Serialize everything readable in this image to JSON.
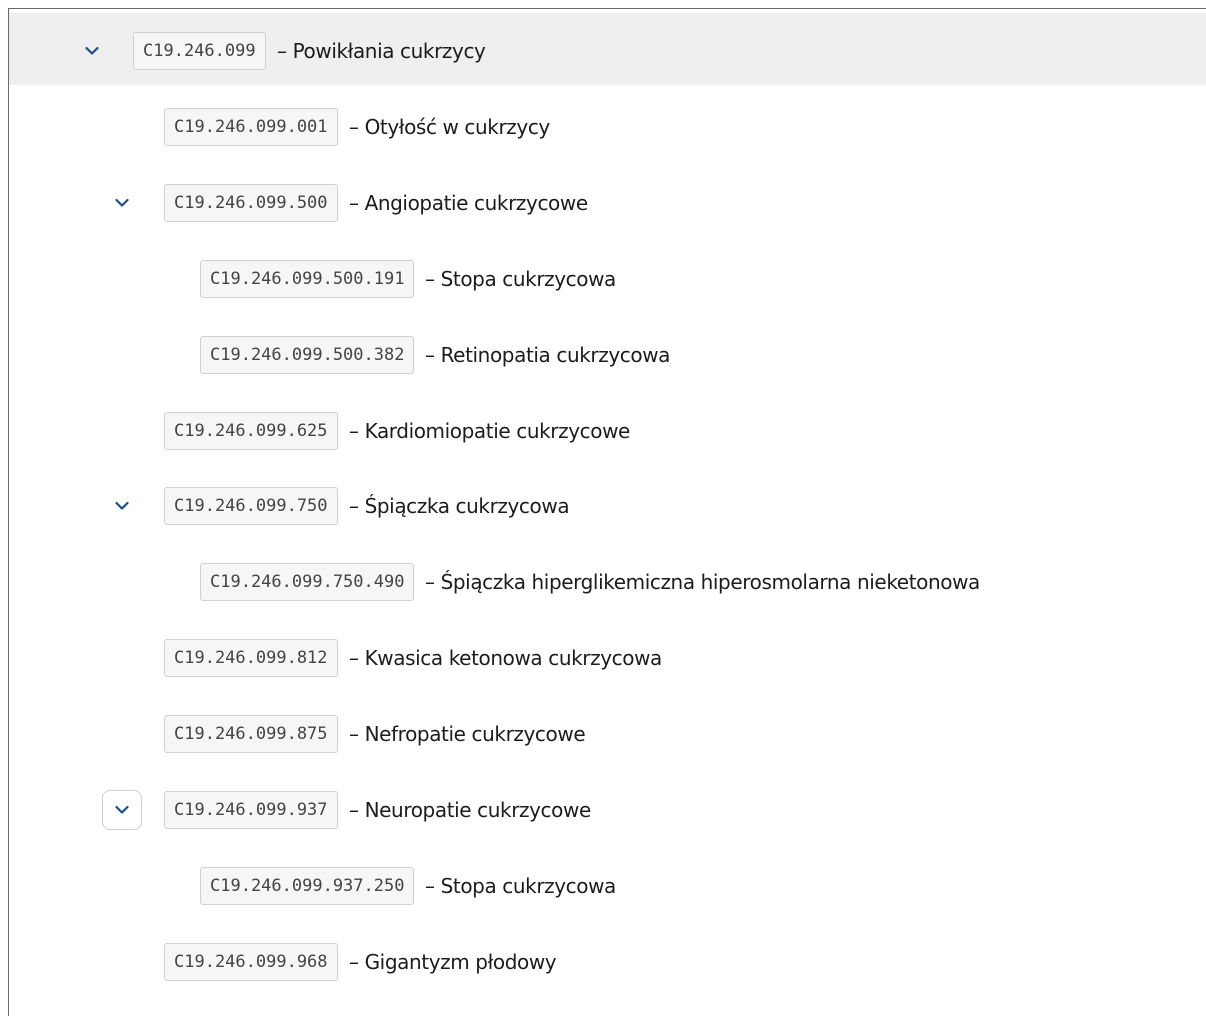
{
  "colors": {
    "chevron": "#1d4e89",
    "selected_row_bg": "#efefef",
    "code_bg": "#f6f6f6",
    "code_border": "#d0d0d0"
  },
  "tree": {
    "toggle_icon": "chevron-down-icon",
    "separator": "–",
    "items": [
      {
        "code": "C19.246.099",
        "label": "Powikłania cukrzycy",
        "level": 0,
        "expanded": true,
        "selected": true
      },
      {
        "code": "C19.246.099.001",
        "label": "Otyłość w cukrzycy",
        "level": 1,
        "expanded": false
      },
      {
        "code": "C19.246.099.500",
        "label": "Angiopatie cukrzycowe",
        "level": 1,
        "expanded": true
      },
      {
        "code": "C19.246.099.500.191",
        "label": "Stopa cukrzycowa",
        "level": 2,
        "expanded": false
      },
      {
        "code": "C19.246.099.500.382",
        "label": "Retinopatia cukrzycowa",
        "level": 2,
        "expanded": false
      },
      {
        "code": "C19.246.099.625",
        "label": "Kardiomiopatie cukrzycowe",
        "level": 1,
        "expanded": false
      },
      {
        "code": "C19.246.099.750",
        "label": "Śpiączka cukrzycowa",
        "level": 1,
        "expanded": true
      },
      {
        "code": "C19.246.099.750.490",
        "label": "Śpiączka hiperglikemiczna hiperosmolarna nieketonowa",
        "level": 2,
        "expanded": false
      },
      {
        "code": "C19.246.099.812",
        "label": "Kwasica ketonowa cukrzycowa",
        "level": 1,
        "expanded": false
      },
      {
        "code": "C19.246.099.875",
        "label": "Nefropatie cukrzycowe",
        "level": 1,
        "expanded": false
      },
      {
        "code": "C19.246.099.937",
        "label": "Neuropatie cukrzycowe",
        "level": 1,
        "expanded": true,
        "focused": true
      },
      {
        "code": "C19.246.099.937.250",
        "label": "Stopa cukrzycowa",
        "level": 2,
        "expanded": false
      },
      {
        "code": "C19.246.099.968",
        "label": "Gigantyzm płodowy",
        "level": 1,
        "expanded": false
      }
    ]
  }
}
